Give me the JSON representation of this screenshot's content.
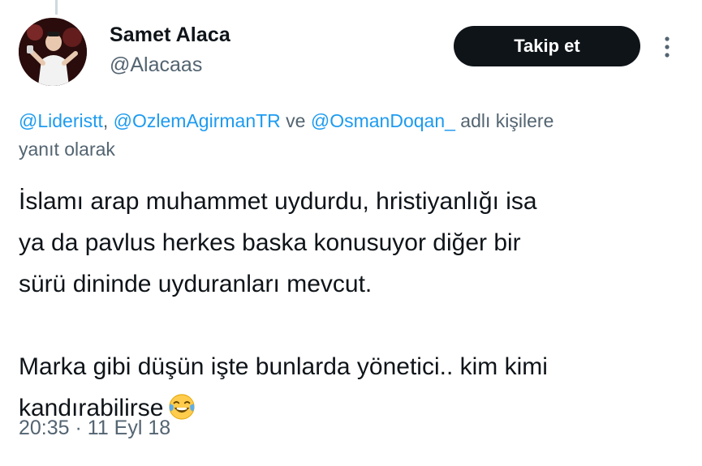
{
  "tweet": {
    "author": {
      "display_name": "Samet Alaca",
      "handle": "@Alacaas"
    },
    "follow_button_label": "Takip et",
    "reply_to": {
      "mentions": [
        "@Lideristt",
        "@OzlemAgirmanTR",
        "@OsmanDoqan_"
      ],
      "separator": ", ",
      "conjunction": " ve ",
      "suffix": " adlı kişilere",
      "line2": "yanıt olarak"
    },
    "text_lines_para1": [
      "İslamı arap muhammet uydurdu, hristiyanlığı isa",
      "ya da pavlus herkes baska konusuyor diğer bir",
      "sürü dininde uyduranları mevcut."
    ],
    "text_lines_para2": [
      "Marka gibi düşün işte bunlarda yönetici.. kim kimi",
      "kandırabilirse"
    ],
    "emoji_icon": "face-with-tears-of-joy-icon",
    "time": "20:35",
    "dot": " · ",
    "date": "11 Eyl 18"
  },
  "colors": {
    "primary_text": "#0f1419",
    "secondary_text": "#536471",
    "link": "#1d9bf0",
    "button_bg": "#0f1419",
    "button_text": "#ffffff"
  }
}
